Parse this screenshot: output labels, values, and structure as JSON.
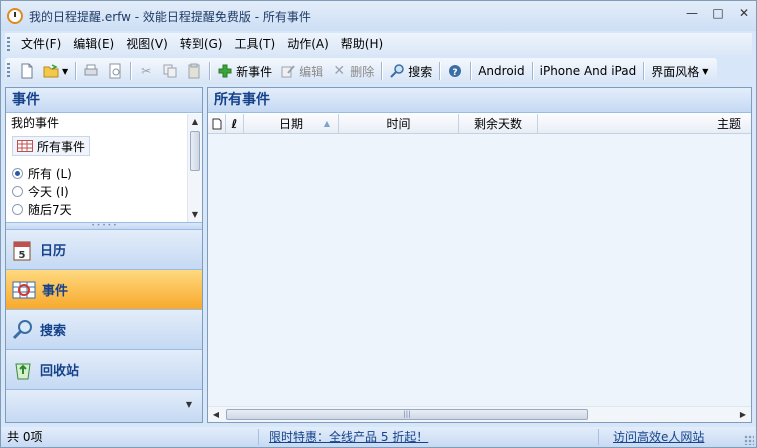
{
  "window": {
    "title": "我的日程提醒.erfw - 效能日程提醒免费版 - 所有事件"
  },
  "menu": [
    "文件(F)",
    "编辑(E)",
    "视图(V)",
    "转到(G)",
    "工具(T)",
    "动作(A)",
    "帮助(H)"
  ],
  "toolbar": {
    "new_event": "新事件",
    "edit": "编辑",
    "delete": "删除",
    "search": "搜索",
    "android": "Android",
    "iphone": "iPhone And iPad",
    "theme": "界面风格"
  },
  "left": {
    "header": "事件",
    "my_events": "我的事件",
    "all_events": "所有事件",
    "radios": [
      {
        "label": "所有 (L)",
        "checked": true
      },
      {
        "label": "今天 (I)",
        "checked": false
      },
      {
        "label": "随后7天",
        "checked": false
      }
    ],
    "nav": [
      {
        "label": "日历",
        "active": false
      },
      {
        "label": "事件",
        "active": true
      },
      {
        "label": "搜索",
        "active": false
      },
      {
        "label": "回收站",
        "active": false
      }
    ]
  },
  "right": {
    "header": "所有事件",
    "columns": [
      "日期",
      "时间",
      "剩余天数",
      "主题"
    ]
  },
  "status": {
    "count": "共 0项",
    "promo": "限时特惠：全线产品 5 折起！",
    "link": "访问高效e人网站"
  }
}
